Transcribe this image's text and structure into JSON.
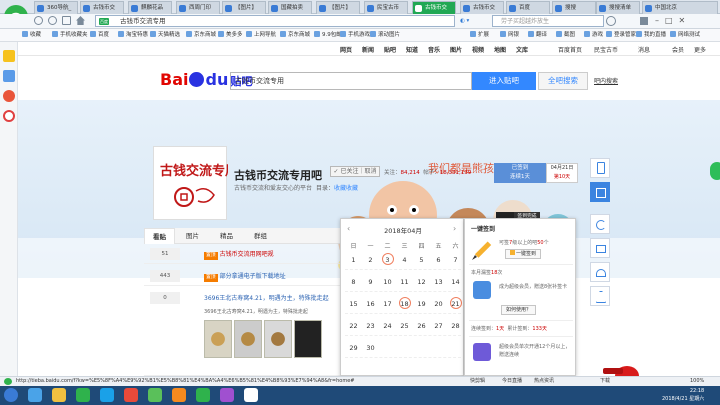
{
  "browser": {
    "tabs": [
      {
        "label": "360导航_"
      },
      {
        "label": "古钱币交"
      },
      {
        "label": "麒麟花品"
      },
      {
        "label": "西周门印"
      },
      {
        "label": "【图片】"
      },
      {
        "label": "国藏拍卖"
      },
      {
        "label": "【图片】"
      },
      {
        "label": "民宝古币"
      },
      {
        "label": "古钱币交"
      },
      {
        "label": "古钱币交"
      },
      {
        "label": "百度"
      },
      {
        "label": "搜搜"
      },
      {
        "label": "搜搜清单"
      },
      {
        "label": "中国北京"
      }
    ],
    "address_badge": "百度",
    "address": "古钱币交流专用",
    "search_placeholder": "劳子买超越炸放生",
    "favorites": [
      "收藏",
      "手机收藏夹",
      "百度",
      "淘宝特惠",
      "天猫精选",
      "京东商城",
      "美多多",
      "上网导航",
      "京东商城",
      "9.9包邮",
      "手机游戏",
      "滚动图片"
    ],
    "right_toolbar": [
      "扩展",
      "网银",
      "翻译",
      "截图",
      "游戏",
      "登录管家",
      "我的直播",
      "网络测试"
    ]
  },
  "topnav": {
    "left": [
      "网页",
      "新闻",
      "贴吧",
      "知道",
      "音乐",
      "图片",
      "视频",
      "地图",
      "文库"
    ],
    "right": [
      "百度首页",
      "民宝古币",
      "消息",
      "会员",
      "更多"
    ]
  },
  "search": {
    "query": "古钱币交流专用",
    "enter_button": "进入贴吧",
    "all_button": "全吧搜索",
    "help_link": "吧内搜索"
  },
  "banner": {
    "slogan_art": "我们都是熊孩子"
  },
  "forum": {
    "logo_text": "古钱交流专用",
    "title": "古钱币交流专用吧",
    "follow_label": "✓ 已关注｜取消",
    "followers_label": "关注：",
    "followers_count": "84,214",
    "posts_label": "帖子：",
    "posts_count": "18,331,139",
    "slogan": "古钱币交流和爱友交心的平台",
    "catalog_label": "目录：",
    "catalog_value": "收藏收藏",
    "sign_status": "已签到",
    "sign_streak": "连续1天",
    "sign_date": "04月21日",
    "sign_rank": "第10天",
    "tooltip": "签到完成"
  },
  "tabs": [
    "看贴",
    "图片",
    "精品",
    "群组"
  ],
  "threads": [
    {
      "replies": "51",
      "tag": "置顶",
      "title": "古钱币交流用网吧规"
    },
    {
      "replies": "443",
      "tag": "置顶",
      "title": "部分拿通电子版下载地址"
    },
    {
      "replies": "0",
      "title": "3696王北古寿窝4.21，明遇为主，特殊批走起",
      "sub": "3696王北古寿窝4.21，明遇为主，特殊批走起"
    }
  ],
  "calendar": {
    "header": "2018年04月",
    "prev": "‹",
    "next": "›",
    "weekdays": [
      "日",
      "一",
      "二",
      "三",
      "四",
      "五",
      "六"
    ],
    "days": [
      [
        "1",
        "2",
        "3",
        "4",
        "5",
        "6",
        "7"
      ],
      [
        "8",
        "9",
        "10",
        "11",
        "12",
        "13",
        "14"
      ],
      [
        "15",
        "16",
        "17",
        "18",
        "19",
        "20",
        "21"
      ],
      [
        "22",
        "23",
        "24",
        "25",
        "26",
        "27",
        "28"
      ],
      [
        "29",
        "30",
        "",
        "",
        "",
        "",
        ""
      ]
    ],
    "signed_days": [
      "3",
      "18",
      "21"
    ]
  },
  "sign_panel": {
    "title": "一键签到",
    "subtitle_pre": "可签",
    "subtitle_lv": "7",
    "subtitle_post": "级以上的吧",
    "subtitle_count": "50",
    "subtitle_tail": "个",
    "one_click_button": "一键签到",
    "monthly_label": "本月漏签",
    "monthly_count": "18",
    "monthly_tail": "次",
    "member_text": "成为超级会员，赠送8张补签卡",
    "how_button": "如何使用？",
    "streak_label": "连续签到：",
    "streak_value": "1天",
    "total_label": "累计签到：",
    "total_value": "133天",
    "vip_text": "超级会员单次开通12个月以上，赠送连续"
  },
  "statusbar": {
    "url": "http://tieba.baidu.com/f?kw=%E5%8F%A4%E9%92%B1%E5%B8%81%E4%BA%A4%E6%B5%81%E4%B8%93%E7%94%A8&fr=home#",
    "right": [
      "快剪辑",
      "今日直播",
      "热点资讯",
      "下载",
      "100%"
    ]
  },
  "clock": {
    "time": "22:18",
    "date": "2018/4/21 星期六"
  }
}
